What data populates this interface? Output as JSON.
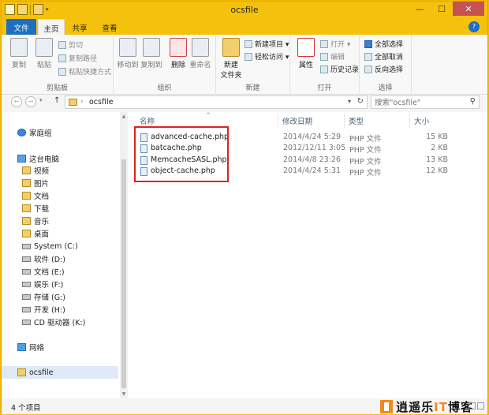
{
  "window": {
    "title": "ocsfile",
    "minimize_glyph": "—",
    "maximize_glyph": "☐",
    "close_glyph": "✕"
  },
  "quick_access": {
    "dropdown_glyph": "▾"
  },
  "tabs": [
    {
      "label": "文件"
    },
    {
      "label": "主页"
    },
    {
      "label": "共享"
    },
    {
      "label": "查看"
    }
  ],
  "ribbon_toggle_glyph": "?",
  "ribbon": {
    "clipboard": {
      "label": "剪贴板",
      "copy": "复制",
      "paste": "粘贴",
      "cut": "剪切",
      "copy_path": "复制路径",
      "paste_shortcut": "粘贴快捷方式"
    },
    "organize": {
      "label": "组织",
      "move_to": "移动到",
      "copy_to": "复制到",
      "delete": "删除",
      "rename": "重命名"
    },
    "new": {
      "label": "新建",
      "new_folder": "新建\n文件夹",
      "new_folder_line1": "新建",
      "new_folder_line2": "文件夹",
      "new_item": "新建项目 ▾",
      "easy_access": "轻松访问 ▾"
    },
    "open": {
      "label": "打开",
      "properties": "属性",
      "open": "打开 ▾",
      "edit": "编辑",
      "history": "历史记录"
    },
    "select": {
      "label": "选择",
      "select_all": "全部选择",
      "select_none": "全部取消",
      "invert": "反向选择"
    }
  },
  "navigation": {
    "back_glyph": "←",
    "forward_glyph": "→",
    "up_glyph": "↑",
    "history_glyph": "▾",
    "address_sep": "›",
    "address_crumb": "ocsfile",
    "address_dropdown": "▾",
    "refresh_glyph": "↻",
    "search_placeholder": "搜索\"ocsfile\"",
    "search_glyph": "⚲"
  },
  "sidebar": {
    "homegroup": "家庭组",
    "this_pc": "这台电脑",
    "items": [
      {
        "label": "视频"
      },
      {
        "label": "图片"
      },
      {
        "label": "文档"
      },
      {
        "label": "下载"
      },
      {
        "label": "音乐"
      },
      {
        "label": "桌面"
      },
      {
        "label": "System (C:)"
      },
      {
        "label": "软件 (D:)"
      },
      {
        "label": "文档 (E:)"
      },
      {
        "label": "娱乐 (F:)"
      },
      {
        "label": "存储 (G:)"
      },
      {
        "label": "开发 (H:)"
      },
      {
        "label": "CD 驱动器 (K:)"
      }
    ],
    "network": "网络",
    "current_folder": "ocsfile",
    "scroll_up": "▲",
    "scroll_down": "▼"
  },
  "file_list": {
    "columns": {
      "name": "名称",
      "modified": "修改日期",
      "type": "类型",
      "size": "大小"
    },
    "sort_glyph": "^",
    "rows": [
      {
        "name": "advanced-cache.php",
        "modified": "2014/4/24 5:29",
        "type": "PHP 文件",
        "size": "15 KB"
      },
      {
        "name": "batcache.php",
        "modified": "2012/12/11 3:05",
        "type": "PHP 文件",
        "size": "2 KB"
      },
      {
        "name": "MemcacheSASL.php",
        "modified": "2014/4/8 23:26",
        "type": "PHP 文件",
        "size": "13 KB"
      },
      {
        "name": "object-cache.php",
        "modified": "2014/4/24 5:31",
        "type": "PHP 文件",
        "size": "12 KB"
      }
    ]
  },
  "status": {
    "item_count": "4 个项目"
  },
  "watermark": {
    "text_before": "逍遥乐",
    "text_it": "IT",
    "text_after": "博客"
  },
  "colors": {
    "titlebar": "#f4c20d",
    "file_tab": "#1e6fc1",
    "highlight_border": "#e02020",
    "watermark_accent": "#f08a1c"
  }
}
